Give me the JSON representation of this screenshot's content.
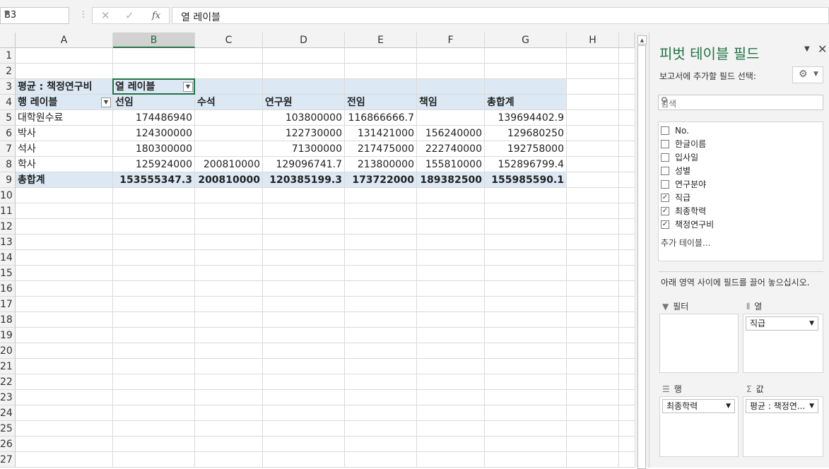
{
  "formula_bar": {
    "name_box": "B3",
    "separator": "⋮",
    "cancel_icon": "✕",
    "enter_icon": "✓",
    "fx_label": "fx",
    "content": "열 레이블"
  },
  "sheet": {
    "columns": [
      "A",
      "B",
      "C",
      "D",
      "E",
      "F",
      "G",
      "H"
    ],
    "rows": [
      "1",
      "2",
      "3",
      "4",
      "5",
      "6",
      "7",
      "8",
      "9",
      "10",
      "11",
      "12",
      "13",
      "14",
      "15",
      "16",
      "17",
      "18",
      "19",
      "20",
      "21",
      "22",
      "23",
      "24",
      "25",
      "26",
      "27"
    ],
    "selected_column": "B",
    "selected_cell": "B3"
  },
  "pivot": {
    "value_label": "평균 : 책정연구비",
    "col_labels_header": "열 레이블",
    "row_labels_header": "행 레이블",
    "column_headers": [
      "선임",
      "수석",
      "연구원",
      "전임",
      "책임",
      "총합계"
    ],
    "rows": [
      {
        "label": "대학원수료",
        "values": [
          "174486940",
          "",
          "103800000",
          "116866666.7",
          "",
          "139694402.9"
        ]
      },
      {
        "label": "박사",
        "values": [
          "124300000",
          "",
          "122730000",
          "131421000",
          "156240000",
          "129680250"
        ]
      },
      {
        "label": "석사",
        "values": [
          "180300000",
          "",
          "71300000",
          "217475000",
          "222740000",
          "192758000"
        ]
      },
      {
        "label": "학사",
        "values": [
          "125924000",
          "200810000",
          "129096741.7",
          "213800000",
          "155810000",
          "152896799.4"
        ]
      }
    ],
    "grand_total": {
      "label": "총합계",
      "values": [
        "153555347.3",
        "200810000",
        "120385199.3",
        "173722000",
        "189382500",
        "155985590.1"
      ]
    }
  },
  "pane": {
    "title": "피벗 테이블 필드",
    "choose_fields": "보고서에 추가할 필드 선택:",
    "search_placeholder": "검색",
    "fields": [
      {
        "name": "No.",
        "checked": false
      },
      {
        "name": "한글이름",
        "checked": false
      },
      {
        "name": "입사일",
        "checked": false
      },
      {
        "name": "성별",
        "checked": false
      },
      {
        "name": "연구분야",
        "checked": false
      },
      {
        "name": "직급",
        "checked": true
      },
      {
        "name": "최종학력",
        "checked": true
      },
      {
        "name": "책정연구비",
        "checked": true
      }
    ],
    "more_tables": "추가 테이블...",
    "drag_hint": "아래 영역 사이에 필드를 끌어 놓으십시오.",
    "areas": {
      "filter_label": "필터",
      "columns_label": "열",
      "rows_label": "행",
      "values_label": "값",
      "columns_field": "직급",
      "rows_field": "최종학력",
      "values_field": "평균 : 책정연..."
    }
  }
}
